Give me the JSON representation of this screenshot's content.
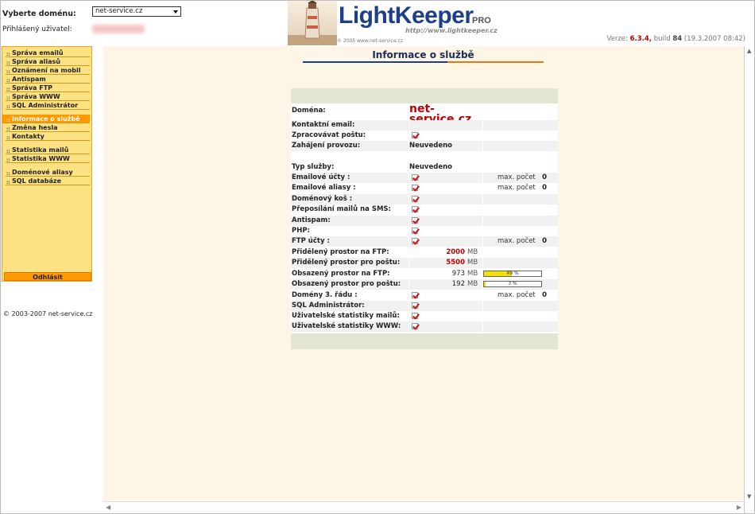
{
  "header": {
    "domain_label": "Vyberte doménu:",
    "domain_selected": "net-service.cz",
    "user_label": "Přihlášený uživatel:",
    "logo_text": "LightKeeper",
    "logo_pro": "PRO",
    "logo_url": "http://www.lightkeeper.cz",
    "logo_copyright": "© 2005 www.net-service.cz",
    "version_label": "Verze:",
    "version_value": "6.3.4,",
    "build_label": "build",
    "build_value": "84",
    "build_date": "(19.3.2007 08:42)"
  },
  "menu": {
    "groups": [
      [
        "Správa emailů",
        "Správa aliasů",
        "Oznámení na mobil",
        "Antispam",
        "Správa FTP",
        "Správa WWW",
        "SQL Administrátor"
      ],
      [
        "Informace o službě",
        "Změna hesla",
        "Kontakty"
      ],
      [
        "Statistika mailů",
        "Statistika WWW"
      ],
      [
        "Doménové aliasy",
        "SQL databáze"
      ]
    ],
    "active": "Informace o službě",
    "logout": "Odhlásit",
    "copyright": "© 2003-2007 net-service.cz"
  },
  "page_title": "Informace o službě",
  "info": {
    "domain_label": "Doména:",
    "domain_value": "net-service.cz",
    "contact_label": "Kontaktní email:",
    "mail_label": "Zpracovávat poštu:",
    "start_label": "Zahájení provozu:",
    "start_value": "Neuvedeno",
    "type_label": "Typ služby:",
    "type_value": "Neuvedeno",
    "max_label": "max. počet",
    "rows": [
      {
        "label": "Emailové účty :",
        "checked": true,
        "max": "0"
      },
      {
        "label": "Emailové aliasy :",
        "checked": true,
        "max": "0"
      },
      {
        "label": "Doménový koš :",
        "checked": true
      },
      {
        "label": "Přeposílání mailů na SMS:",
        "checked": true
      },
      {
        "label": "Antispam:",
        "checked": true
      },
      {
        "label": "PHP:",
        "checked": true
      },
      {
        "label": "FTP účty :",
        "checked": true,
        "max": "0"
      }
    ],
    "ftp_space_label": "Přidělený prostor na FTP:",
    "ftp_space_value": "2000",
    "mail_space_label": "Přidělený prostor pro poštu:",
    "mail_space_value": "5500",
    "unit": "MB",
    "ftp_used_label": "Obsazený prostor na FTP:",
    "ftp_used_value": "973",
    "ftp_used_pct": 49,
    "ftp_used_pct_text": "49 %",
    "mail_used_label": "Obsazený prostor pro poštu:",
    "mail_used_value": "192",
    "mail_used_pct": 3,
    "mail_used_pct_text": "3 %",
    "rows2": [
      {
        "label": "Domény 3. řádu :",
        "checked": true,
        "max": "0"
      },
      {
        "label": "SQL Administrátor:",
        "checked": true
      },
      {
        "label": "Uživatelské statistiky mailů:",
        "checked": true
      },
      {
        "label": "Uživatelské statistiky WWW:",
        "checked": true
      }
    ]
  }
}
